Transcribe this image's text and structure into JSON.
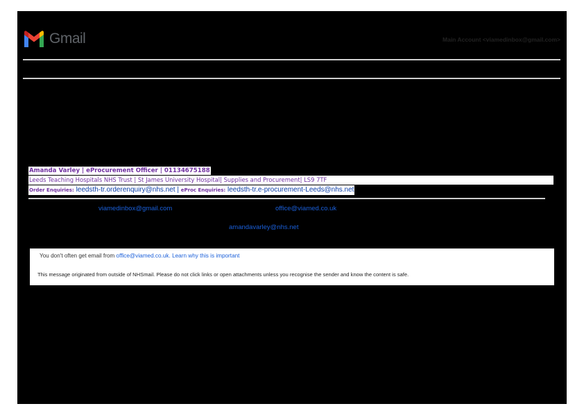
{
  "app": {
    "logo_text": "Gmail",
    "account": "Main Account <viamedinbox@gmail.com>"
  },
  "signature": {
    "name_line": "Amanda Varley | eProcurement Officer | 01134675188",
    "org_line": "Leeds Teaching Hospitals NHS Trust | St James University Hospital| Supplies and Procurement| LS9 7TF",
    "order_label": "Order Enquiries:",
    "order_email": "leedsth-tr.orderenquiry@nhs.net",
    "separator": "|",
    "eproc_label": "eProc Enquiries:",
    "eproc_email": "leedsth-tr.e-procurement-Leeds@nhs.net"
  },
  "headers": {
    "from_email": "viamedinbox@gmail.com",
    "to_email": "office@viamed.co.uk",
    "cc_email": "amandavarley@nhs.net"
  },
  "notice": {
    "prefix": "You don't often get email from",
    "sender": "office@viamed.co.uk",
    "link": "Learn why this is important",
    "external_warning": "This message originated from outside of NHSmail. Please do not click links or open attachments unless you recognise the sender and know the content is safe."
  },
  "colors": {
    "signature_purple": "#7030a0",
    "link_blue": "#1a5fd9",
    "page_background": "#000000"
  }
}
